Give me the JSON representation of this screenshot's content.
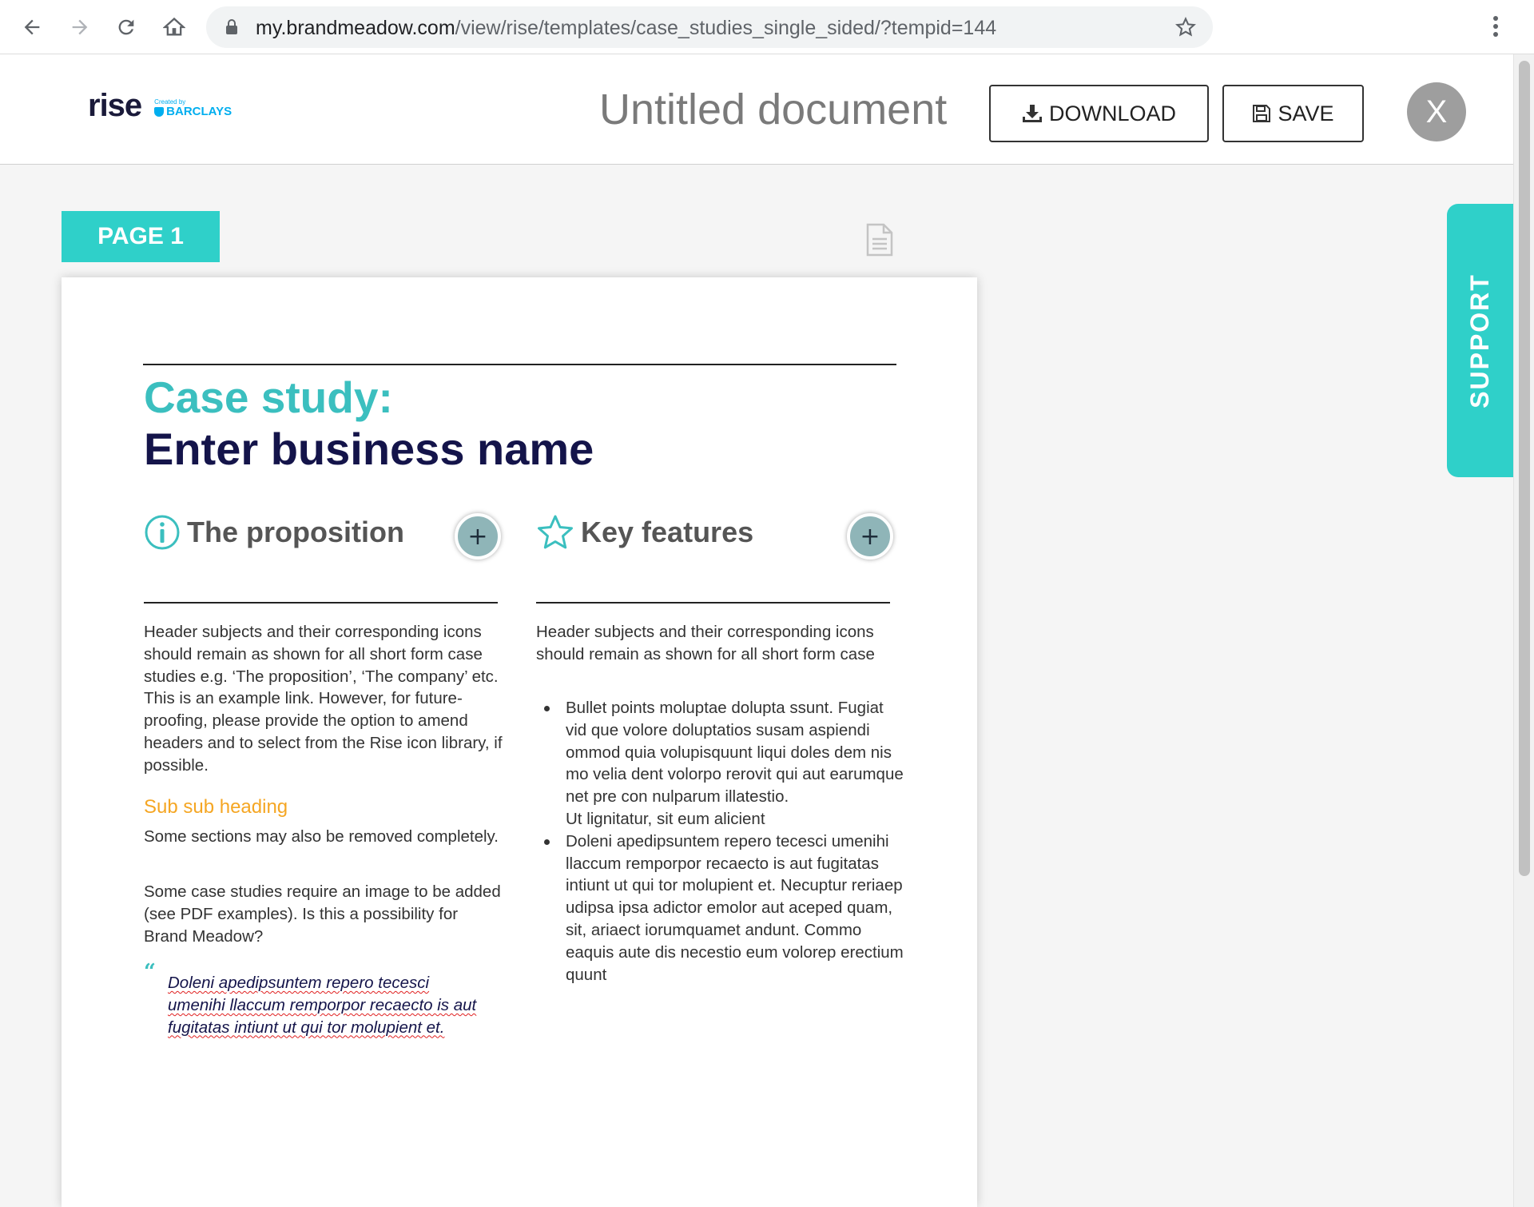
{
  "browser": {
    "url_domain": "my.brandmeadow.com",
    "url_path": "/view/rise/templates/case_studies_single_sided/?tempid=144"
  },
  "header": {
    "logo_rise": "rise",
    "logo_created_by": "Created by",
    "logo_barclays": "BARCLAYS",
    "doc_title": "Untitled document",
    "download_label": "DOWNLOAD",
    "save_label": "SAVE",
    "close_label": "X"
  },
  "page_tab": "PAGE 1",
  "support_label": "SUPPORT",
  "document": {
    "title": "Case study:",
    "business_name": "Enter business name",
    "col1": {
      "heading": "The proposition",
      "icon": "info-icon",
      "paragraph": "Header subjects and their corresponding icons should remain as shown for all short form case studies e.g. ‘The proposition’, ‘The company’ etc. This is an example link. However, for future-proofing, please provide the option to amend headers and to select from the Rise icon library, if possible.",
      "sub_heading": "Sub sub heading",
      "paragraph2": "Some sections may also be removed completely.",
      "paragraph3": "Some case studies require an image to be added (see PDF examples). Is this a possibility for Brand Meadow?",
      "quote_mark": "“",
      "quote": "Doleni apedipsuntem repero tecesci umenihi llaccum remporpor recaecto is aut fugitatas intiunt ut qui tor molupient et."
    },
    "col2": {
      "heading": "Key features",
      "icon": "star-icon",
      "paragraph": "Header subjects and their corresponding icons should remain as shown for all short form case",
      "bullet1_line1": "Bullet points moluptae dolupta ssunt. Fugiat vid que volore doluptatios susam aspiendi ommod quia volupisquunt liqui doles dem nis mo velia dent volorpo rerovit qui aut earumque net pre con nulparum illatestio.",
      "bullet1_line2": "Ut lignitatur, sit eum alicient",
      "bullet2": "Doleni apedipsuntem repero tecesci umenihi llaccum remporpor recaecto is aut fugitatas intiunt ut qui tor molupient et. Necuptur reriaep udipsa ipsa adictor emolor aut aceped quam, sit, ariaect iorumquamet andunt. Commo eaquis aute dis necestio eum volorep erectium quunt"
    }
  },
  "colors": {
    "teal": "#2fd0c9",
    "title_teal": "#3bbfbf",
    "navy": "#14144a",
    "orange": "#f5a623"
  }
}
